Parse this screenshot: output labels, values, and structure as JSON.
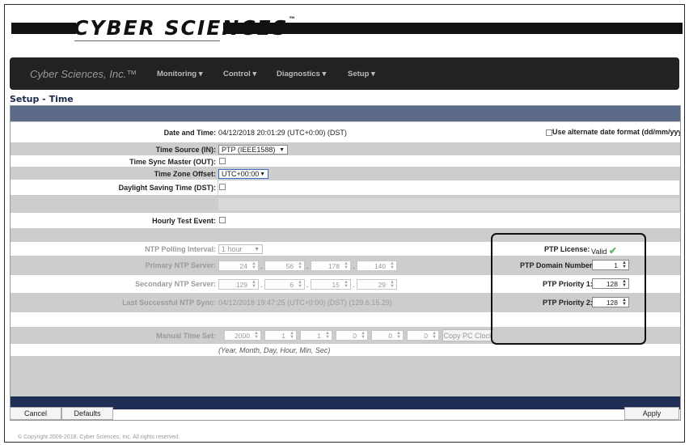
{
  "header": {
    "logo_text": "CYBER SCIENCES",
    "logo_tm": "™"
  },
  "navbar": {
    "brand": "Cyber Sciences, Inc.™",
    "items": [
      "Monitoring ▾",
      "Control ▾",
      "Diagnostics ▾",
      "Setup ▾"
    ]
  },
  "page": {
    "title": "Setup - Time"
  },
  "form": {
    "date_time_label": "Date and Time:",
    "date_time_value": "04/12/2018 20:01:29 (UTC+0:00) (DST)",
    "alt_date_label": "Use alternate date format (dd/mm/yyyy)",
    "time_source_label": "Time Source (IN):",
    "time_source_value": "PTP (IEEE1588)",
    "sync_master_label": "Time Sync Master (OUT):",
    "tz_offset_label": "Time Zone Offset:",
    "tz_offset_value": "UTC+00:00",
    "dst_label": "Daylight Saving Time (DST):",
    "hourly_test_label": "Hourly Test Event:",
    "ntp_interval_label": "NTP Polling Interval:",
    "ntp_interval_value": "1 hour",
    "primary_ntp_label": "Primary NTP Server:",
    "primary_ntp": [
      "24",
      "56",
      "178",
      "140"
    ],
    "secondary_ntp_label": "Secondary NTP Server:",
    "secondary_ntp": [
      "129",
      "6",
      "15",
      "29"
    ],
    "last_sync_label": "Last Successful NTP Sync:",
    "last_sync_value": "04/12/2018 19:47:25 (UTC+0:00) (DST) (129.6.15.29)",
    "manual_time_label": "Manual Time Set:",
    "manual_time": [
      "2000",
      "1",
      "1",
      "0",
      "0",
      "0"
    ],
    "copy_pc_clock": "Copy PC Clock",
    "manual_hint": "(Year, Month, Day, Hour, Min, Sec)"
  },
  "ptp": {
    "license_label": "PTP License:",
    "license_value": "Valid",
    "domain_label": "PTP Domain Number:",
    "domain_value": "1",
    "priority1_label": "PTP Priority 1:",
    "priority1_value": "128",
    "priority2_label": "PTP Priority 2:",
    "priority2_value": "128"
  },
  "footer": {
    "cancel": "Cancel",
    "defaults": "Defaults",
    "apply": "Apply",
    "copyright": "© Copyright 2009-2018. Cyber Sciences, Inc.  All rights reserved."
  },
  "colors": {
    "navbar": "#222222",
    "header_band": "#5b6a88",
    "navy_band": "#1f2e55",
    "valid_check": "#5cb85c"
  }
}
